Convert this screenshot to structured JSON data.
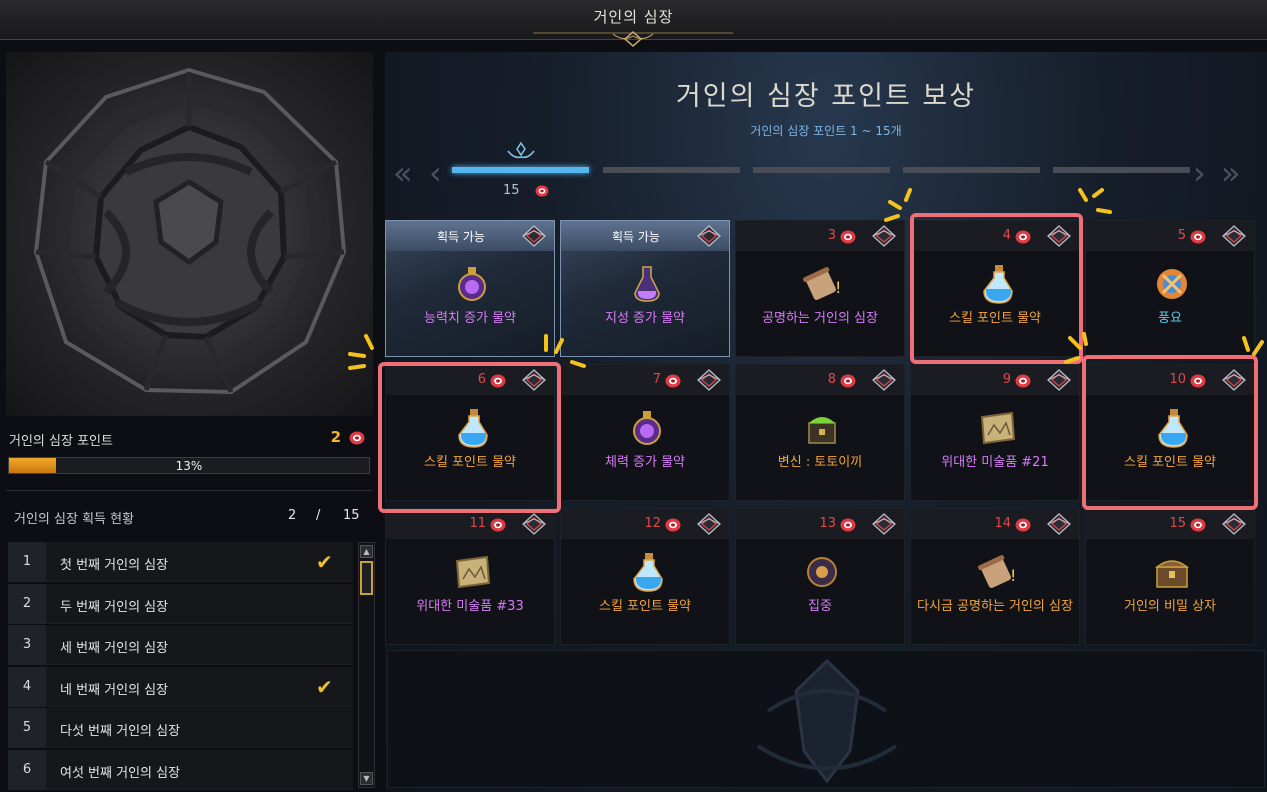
{
  "window": {
    "title": "거인의 심장"
  },
  "left": {
    "points_label": "거인의 심장 포인트",
    "points_value": "2",
    "progress_percent": 13,
    "progress_text": "13%",
    "status_title": "거인의 심장 획득 현황",
    "status_current": "2",
    "status_sep": "/",
    "status_total": "15",
    "list": [
      {
        "num": "1",
        "name": "첫 번째 거인의 심장",
        "done": true
      },
      {
        "num": "2",
        "name": "두 번째 거인의 심장",
        "done": false
      },
      {
        "num": "3",
        "name": "세 번째 거인의 심장",
        "done": false
      },
      {
        "num": "4",
        "name": "네 번째 거인의 심장",
        "done": true
      },
      {
        "num": "5",
        "name": "다섯 번째 거인의 심장",
        "done": false
      },
      {
        "num": "6",
        "name": "여섯 번째 거인의 심장",
        "done": false
      }
    ]
  },
  "rewards": {
    "title": "거인의 심장 포인트 보상",
    "subtitle": "거인의 심장 포인트 1 ~ 15개",
    "tab_count": "15",
    "available_label": "획득 가능",
    "cells": [
      {
        "num": "",
        "available": true,
        "name": "능력치 증가 물약",
        "color": "purple",
        "icon": "orb-potion-icon"
      },
      {
        "num": "",
        "available": true,
        "name": "지성 증가 물약",
        "color": "purple",
        "icon": "bottle-potion-icon"
      },
      {
        "num": "3",
        "available": false,
        "name": "공명하는 거인의 심장",
        "color": "purple",
        "icon": "scroll-icon"
      },
      {
        "num": "4",
        "available": false,
        "name": "스킬 포인트 물약",
        "color": "orange",
        "icon": "blue-potion-icon"
      },
      {
        "num": "5",
        "available": false,
        "name": "풍요",
        "color": "blue",
        "icon": "harvest-icon"
      },
      {
        "num": "6",
        "available": false,
        "name": "스킬 포인트 물약",
        "color": "orange",
        "icon": "blue-potion-icon"
      },
      {
        "num": "7",
        "available": false,
        "name": "체력 증가 물약",
        "color": "purple",
        "icon": "orb-potion-icon"
      },
      {
        "num": "8",
        "available": false,
        "name": "변신 : 토토이끼",
        "color": "orange",
        "icon": "chest-green-icon"
      },
      {
        "num": "9",
        "available": false,
        "name": "위대한 미술품 #21",
        "color": "purple",
        "icon": "painting-icon"
      },
      {
        "num": "10",
        "available": false,
        "name": "스킬 포인트 물약",
        "color": "orange",
        "icon": "blue-potion-icon"
      },
      {
        "num": "11",
        "available": false,
        "name": "위대한 미술품 #33",
        "color": "purple",
        "icon": "painting-icon"
      },
      {
        "num": "12",
        "available": false,
        "name": "스킬 포인트 물약",
        "color": "orange",
        "icon": "blue-potion-icon"
      },
      {
        "num": "13",
        "available": false,
        "name": "집중",
        "color": "purple",
        "icon": "focus-icon"
      },
      {
        "num": "14",
        "available": false,
        "name": "다시금 공명하는 거인의 심장",
        "color": "orange",
        "icon": "scroll-icon"
      },
      {
        "num": "15",
        "available": false,
        "name": "거인의 비밀 상자",
        "color": "orange",
        "icon": "chest-icon"
      }
    ]
  },
  "colors": {
    "highlight": "#ef6f76",
    "spark": "#f3c21c",
    "accent_tab": "#58b6ee",
    "progress": "#f3a72a"
  }
}
